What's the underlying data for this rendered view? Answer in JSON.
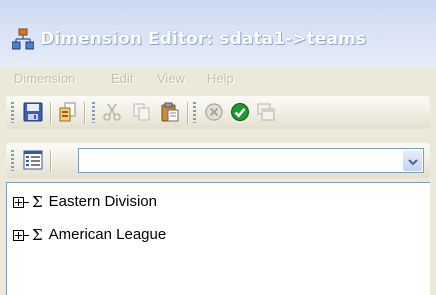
{
  "window": {
    "title": "Dimension Editor: sdata1->teams",
    "app_icon": "dimension-editor-icon"
  },
  "menu": {
    "items": [
      {
        "label": "Dimension",
        "enabled": false
      },
      {
        "label": "Edit",
        "enabled": false
      },
      {
        "label": "View",
        "enabled": false
      },
      {
        "label": "Help",
        "enabled": false
      }
    ]
  },
  "toolbar": {
    "buttons": [
      {
        "icon": "save-icon",
        "enabled": true
      },
      {
        "icon": "import-icon",
        "enabled": true
      },
      {
        "icon": "cut-icon",
        "enabled": false
      },
      {
        "icon": "copy-icon",
        "enabled": false
      },
      {
        "icon": "paste-icon",
        "enabled": true
      },
      {
        "icon": "cancel-icon",
        "enabled": false
      },
      {
        "icon": "apply-check-icon",
        "enabled": true
      },
      {
        "icon": "window-icon",
        "enabled": false
      }
    ]
  },
  "toolbar2": {
    "list_button_icon": "properties-list-icon",
    "combo_value": ""
  },
  "tree": {
    "nodes": [
      {
        "label": "Eastern Division",
        "expander": "plus",
        "icon_glyph": "Σ"
      },
      {
        "label": "American League",
        "expander": "plus",
        "icon_glyph": "Σ"
      }
    ]
  },
  "colors": {
    "title_text": "#ffffff",
    "disabled_text": "#c4c0ae",
    "toolbar_grip": "#7f9db9",
    "apply_green": "#1e9b2e"
  }
}
